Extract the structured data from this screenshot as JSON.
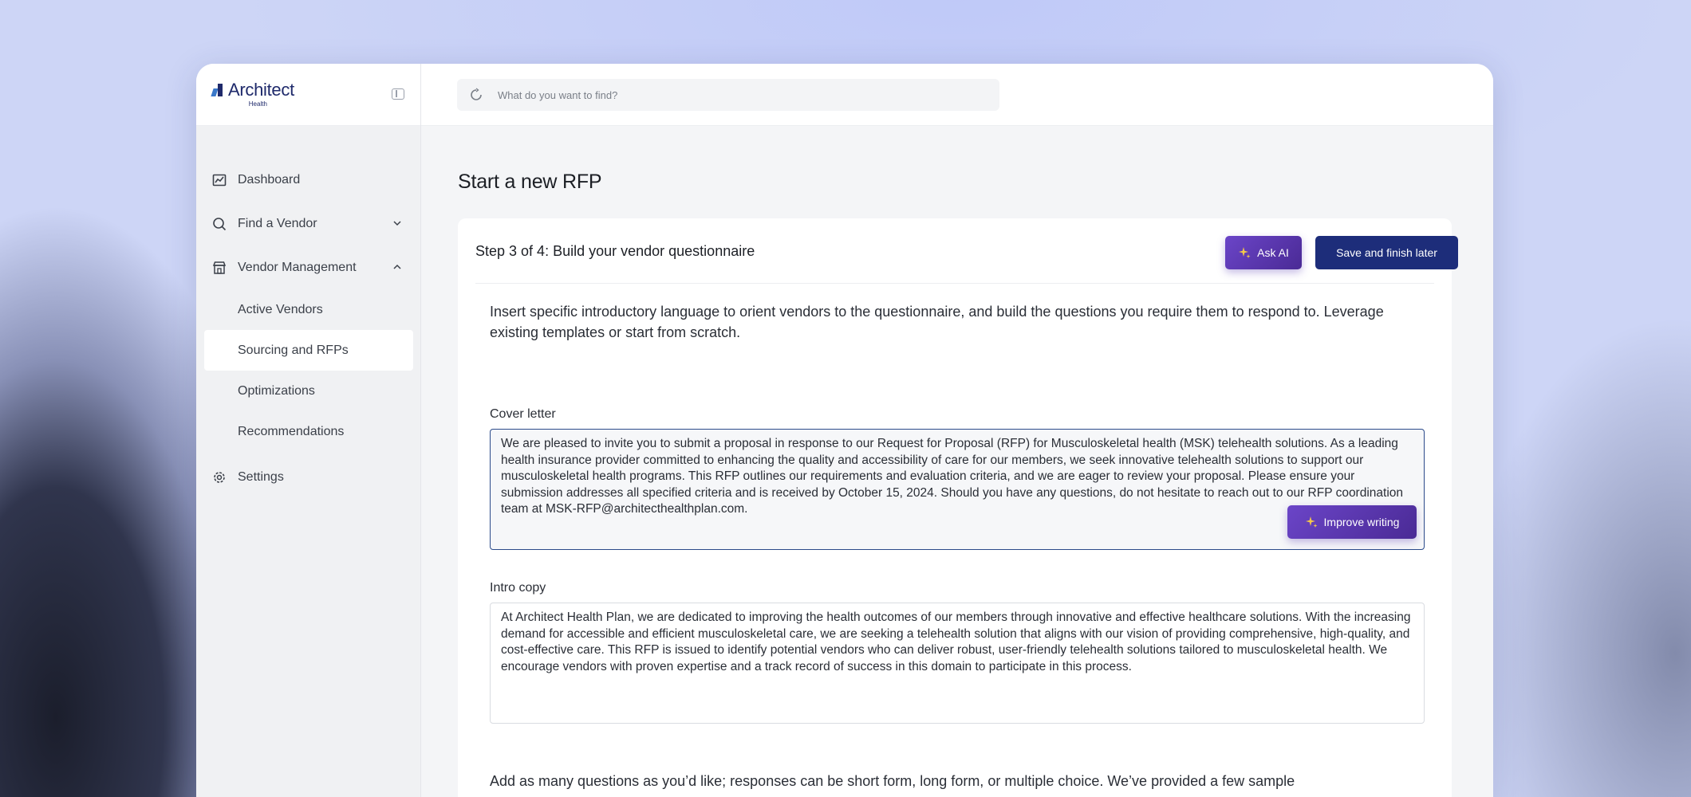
{
  "brand": {
    "name": "Architect",
    "sub": "Health"
  },
  "search": {
    "placeholder": "What do you want to find?"
  },
  "nav": {
    "dashboard": "Dashboard",
    "find_vendor": "Find a Vendor",
    "vendor_management": "Vendor Management",
    "sub_items": [
      "Active Vendors",
      "Sourcing and RFPs",
      "Optimizations",
      "Recommendations"
    ],
    "settings": "Settings"
  },
  "page": {
    "title": "Start a new RFP",
    "step_title": "Step 3 of 4: Build your vendor questionnaire",
    "ask_ai_label": "Ask AI",
    "save_label": "Save and finish later",
    "intro": "Insert specific introductory language to orient vendors to the questionnaire, and build the questions you require them to respond to. Leverage existing templates or start from scratch.",
    "cover_letter_label": "Cover letter",
    "cover_letter_value": "We are pleased to invite you to submit a proposal in response to our Request for Proposal (RFP) for Musculoskeletal health (MSK) telehealth solutions. As a leading health insurance provider committed to enhancing the quality and accessibility of care for our members, we seek innovative telehealth solutions to support our musculoskeletal health programs. This RFP outlines our requirements and evaluation criteria, and we are eager to review your proposal. Please ensure your submission addresses all specified criteria and is received by October 15, 2024. Should you have any questions, do not hesitate to reach out to our RFP coordination team at MSK-RFP@architecthealthplan.com.",
    "improve_label": "Improve writing",
    "intro_copy_label": "Intro copy",
    "intro_copy_value": "At Architect Health Plan, we are dedicated to improving the health outcomes of our members through innovative and effective healthcare solutions. With the increasing demand for accessible and efficient musculoskeletal care, we are seeking a telehealth solution that aligns with our vision of providing comprehensive, high-quality, and cost-effective care. This RFP is issued to identify potential vendors who can deliver robust, user-friendly telehealth solutions tailored to musculoskeletal health. We encourage vendors with proven expertise and a track record of success in this domain to participate in this process.",
    "questions_intro": "Add as many questions as you’d like; responses can be short form, long form, or multiple choice. We’ve provided a few sample"
  },
  "colors": {
    "accent": "#1d2d7a",
    "ai_gradient_start": "#6b45c8",
    "ai_gradient_end": "#4a2a95",
    "avatar": "#1b24d8"
  }
}
